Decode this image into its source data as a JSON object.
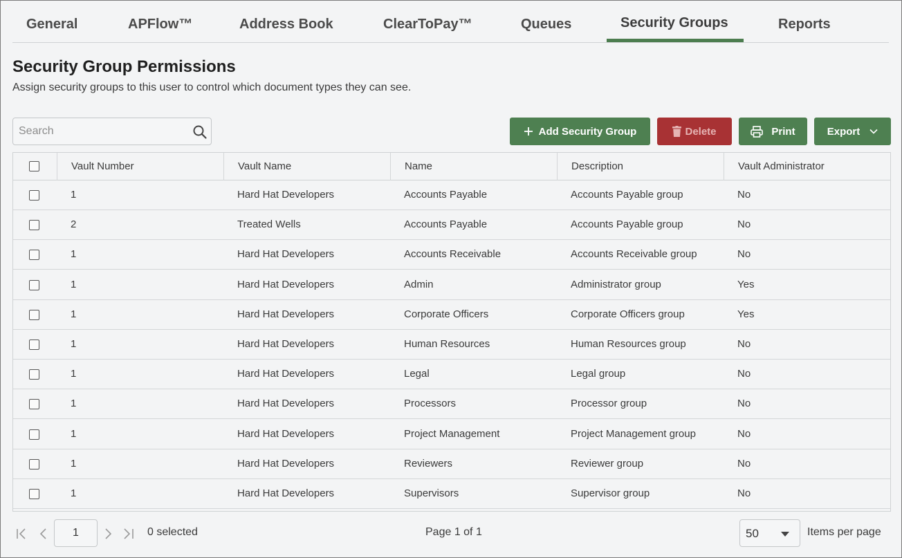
{
  "tabs": [
    {
      "label": "General"
    },
    {
      "label": "APFlow™"
    },
    {
      "label": "Address Book"
    },
    {
      "label": "ClearToPay™"
    },
    {
      "label": "Queues"
    },
    {
      "label": "Security Groups",
      "active": true
    },
    {
      "label": "Reports"
    }
  ],
  "header": {
    "title": "Security Group Permissions",
    "subtitle": "Assign security groups to this user to control which document types they can see."
  },
  "search": {
    "placeholder": "Search",
    "value": ""
  },
  "toolbar": {
    "add_label": "Add Security Group",
    "delete_label": "Delete",
    "print_label": "Print",
    "export_label": "Export"
  },
  "table": {
    "columns": [
      "Vault Number",
      "Vault Name",
      "Name",
      "Description",
      "Vault Administrator"
    ],
    "rows": [
      [
        "1",
        "Hard Hat Developers",
        "Accounts Payable",
        "Accounts Payable group",
        "No"
      ],
      [
        "2",
        "Treated Wells",
        "Accounts Payable",
        "Accounts Payable group",
        "No"
      ],
      [
        "1",
        "Hard Hat Developers",
        "Accounts Receivable",
        "Accounts Receivable group",
        "No"
      ],
      [
        "1",
        "Hard Hat Developers",
        "Admin",
        "Administrator group",
        "Yes"
      ],
      [
        "1",
        "Hard Hat Developers",
        "Corporate Officers",
        "Corporate Officers group",
        "Yes"
      ],
      [
        "1",
        "Hard Hat Developers",
        "Human Resources",
        "Human Resources group",
        "No"
      ],
      [
        "1",
        "Hard Hat Developers",
        "Legal",
        "Legal group",
        "No"
      ],
      [
        "1",
        "Hard Hat Developers",
        "Processors",
        "Processor group",
        "No"
      ],
      [
        "1",
        "Hard Hat Developers",
        "Project Management",
        "Project Management group",
        "No"
      ],
      [
        "1",
        "Hard Hat Developers",
        "Reviewers",
        "Reviewer group",
        "No"
      ],
      [
        "1",
        "Hard Hat Developers",
        "Supervisors",
        "Supervisor group",
        "No"
      ]
    ]
  },
  "footer": {
    "current_page": "1",
    "selected_text": "0 selected",
    "page_info": "Page 1 of 1",
    "items_per_page": "50",
    "items_per_page_label": "Items per page"
  },
  "colors": {
    "accent_green": "#4e8051",
    "danger_red": "#a83234",
    "tab_underline": "#4c7d4f"
  }
}
